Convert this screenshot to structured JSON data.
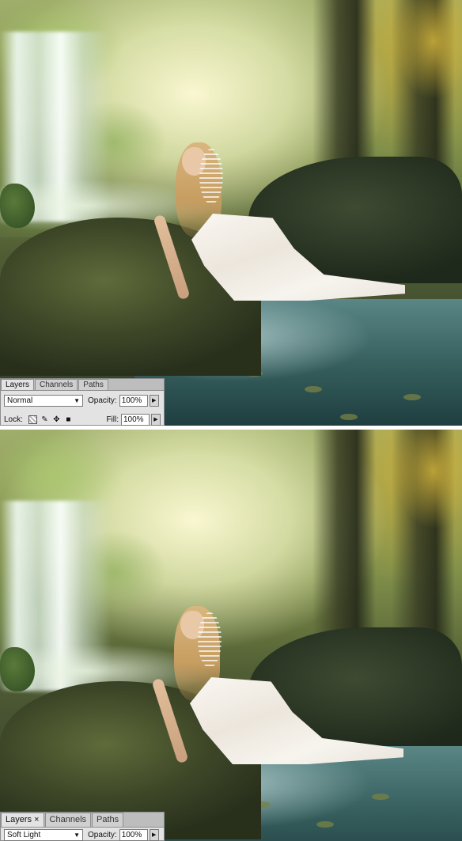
{
  "panel_top": {
    "tabs": [
      "Layers",
      "Channels",
      "Paths"
    ],
    "blend_mode": "Normal",
    "opacity_label": "Opacity:",
    "opacity_value": "100%",
    "lock_label": "Lock:",
    "fill_label": "Fill:",
    "fill_value": "100%"
  },
  "panel_bottom": {
    "tabs": [
      "Layers",
      "Channels",
      "Paths"
    ],
    "close_glyph": "×",
    "blend_mode": "Soft Light",
    "opacity_label": "Opacity:",
    "opacity_value": "100%"
  },
  "icons": {
    "dropdown": "chevron-down-icon",
    "stepper": "chevron-right-icon",
    "lock_transparent": "lock-transparent-pixels-icon",
    "lock_image": "brush-icon",
    "lock_position": "move-icon",
    "lock_all": "lock-icon"
  },
  "colors": {
    "panel_bg": "#e3e3e3",
    "divider": "#ffffff"
  }
}
